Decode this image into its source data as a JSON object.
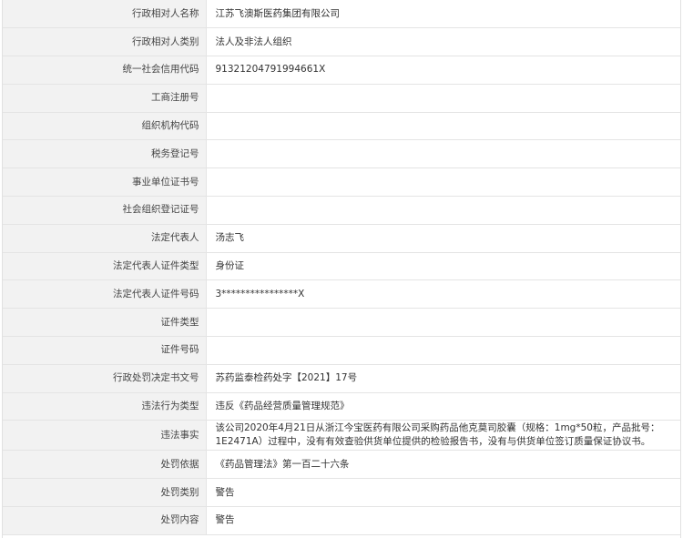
{
  "rows": [
    {
      "label": "行政相对人名称",
      "value": "江苏飞澳斯医药集团有限公司"
    },
    {
      "label": "行政相对人类别",
      "value": "法人及非法人组织"
    },
    {
      "label": "统一社会信用代码",
      "value": "91321204791994661X"
    },
    {
      "label": "工商注册号",
      "value": ""
    },
    {
      "label": "组织机构代码",
      "value": ""
    },
    {
      "label": "税务登记号",
      "value": ""
    },
    {
      "label": "事业单位证书号",
      "value": ""
    },
    {
      "label": "社会组织登记证号",
      "value": ""
    },
    {
      "label": "法定代表人",
      "value": "汤志飞"
    },
    {
      "label": "法定代表人证件类型",
      "value": "身份证"
    },
    {
      "label": "法定代表人证件号码",
      "value": "3****************X"
    },
    {
      "label": "证件类型",
      "value": ""
    },
    {
      "label": "证件号码",
      "value": ""
    },
    {
      "label": "行政处罚决定书文号",
      "value": "苏药监泰检药处字【2021】17号"
    },
    {
      "label": "违法行为类型",
      "value": "违反《药品经营质量管理规范》"
    },
    {
      "label": "违法事实",
      "value": "该公司2020年4月21日从浙江今宝医药有限公司采购药品他克莫司胶囊（规格：1mg*50粒，产品批号：1E2471A）过程中，没有有效查验供货单位提供的检验报告书，没有与供货单位签订质量保证协议书。"
    },
    {
      "label": "处罚依据",
      "value": "《药品管理法》第一百二十六条"
    },
    {
      "label": "处罚类别",
      "value": "警告"
    },
    {
      "label": "处罚内容",
      "value": "警告"
    }
  ]
}
